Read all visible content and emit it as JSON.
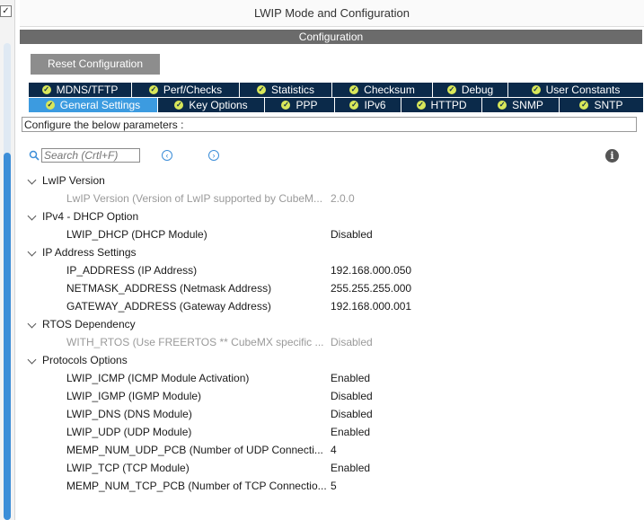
{
  "window": {
    "title": "LWIP Mode and Configuration",
    "section": "Configuration"
  },
  "left_panel": {
    "checkbox_glyph": "✓"
  },
  "toolbar": {
    "reset_label": "Reset Configuration"
  },
  "tabs_row1": [
    {
      "label": "MDNS/TFTP",
      "checked": true,
      "active": false
    },
    {
      "label": "Perf/Checks",
      "checked": true,
      "active": false
    },
    {
      "label": "Statistics",
      "checked": true,
      "active": false
    },
    {
      "label": "Checksum",
      "checked": true,
      "active": false
    },
    {
      "label": "Debug",
      "checked": true,
      "active": false
    },
    {
      "label": "User Constants",
      "checked": true,
      "active": false
    }
  ],
  "tabs_row2": [
    {
      "label": "General Settings",
      "checked": true,
      "active": true
    },
    {
      "label": "Key Options",
      "checked": true,
      "active": false
    },
    {
      "label": "PPP",
      "checked": true,
      "active": false
    },
    {
      "label": "IPv6",
      "checked": true,
      "active": false
    },
    {
      "label": "HTTPD",
      "checked": true,
      "active": false
    },
    {
      "label": "SNMP",
      "checked": true,
      "active": false
    },
    {
      "label": "SNTP",
      "checked": true,
      "active": false
    }
  ],
  "params_header": "Configure the below parameters :",
  "search": {
    "placeholder": "Search (Crtl+F)",
    "value": ""
  },
  "icons": {
    "search": "search-icon",
    "prev": "chevron-left-circle-icon",
    "next": "chevron-right-circle-icon",
    "info": "info-icon"
  },
  "groups": [
    {
      "label": "LwIP Version",
      "params": [
        {
          "name": "LwIP Version (Version of LwIP supported by CubeM...",
          "value": "2.0.0",
          "dim": true
        }
      ]
    },
    {
      "label": "IPv4 - DHCP Option",
      "params": [
        {
          "name": "LWIP_DHCP (DHCP Module)",
          "value": "Disabled",
          "dim": false
        }
      ]
    },
    {
      "label": "IP Address Settings",
      "params": [
        {
          "name": "IP_ADDRESS (IP Address)",
          "value": "192.168.000.050",
          "dim": false
        },
        {
          "name": "NETMASK_ADDRESS (Netmask Address)",
          "value": "255.255.255.000",
          "dim": false
        },
        {
          "name": "GATEWAY_ADDRESS (Gateway Address)",
          "value": "192.168.000.001",
          "dim": false
        }
      ]
    },
    {
      "label": "RTOS Dependency",
      "params": [
        {
          "name": "WITH_RTOS (Use FREERTOS ** CubeMX specific ...",
          "value": "Disabled",
          "dim": true
        }
      ]
    },
    {
      "label": "Protocols Options",
      "params": [
        {
          "name": "LWIP_ICMP (ICMP Module Activation)",
          "value": "Enabled",
          "dim": false
        },
        {
          "name": "LWIP_IGMP (IGMP Module)",
          "value": "Disabled",
          "dim": false
        },
        {
          "name": "LWIP_DNS (DNS Module)",
          "value": "Disabled",
          "dim": false
        },
        {
          "name": "LWIP_UDP (UDP Module)",
          "value": "Enabled",
          "dim": false
        },
        {
          "name": "MEMP_NUM_UDP_PCB (Number of UDP Connecti...",
          "value": "4",
          "dim": false
        },
        {
          "name": "LWIP_TCP (TCP Module)",
          "value": "Enabled",
          "dim": false
        },
        {
          "name": "MEMP_NUM_TCP_PCB (Number of TCP Connectio...",
          "value": "5",
          "dim": false
        }
      ]
    }
  ],
  "colors": {
    "tab_bg": "#0b2a4a",
    "tab_active": "#3c9be0",
    "check_badge": "#d8e75a",
    "section_bar": "#6b6b6b",
    "reset_button": "#8d8d8d",
    "accent": "#3c8ed8"
  }
}
